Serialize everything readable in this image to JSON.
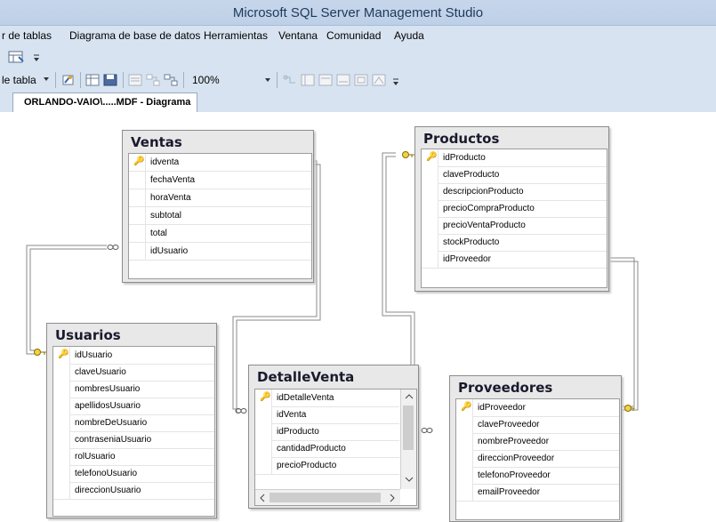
{
  "app": {
    "title": "Microsoft SQL Server Management Studio"
  },
  "menu": [
    "r de tablas",
    "Diagrama de base de datos",
    "Herramientas",
    "Ventana",
    "Comunidad",
    "Ayuda"
  ],
  "toolbar": {
    "table_view_label": "le tabla",
    "zoom": "100%"
  },
  "tab": {
    "label": "ORLANDO-VAIO\\.....MDF - Diagrama"
  },
  "tables": {
    "ventas": {
      "name": "Ventas",
      "columns": [
        "idventa",
        "fechaVenta",
        "horaVenta",
        "subtotal",
        "total",
        "idUsuario"
      ]
    },
    "productos": {
      "name": "Productos",
      "columns": [
        "idProducto",
        "claveProducto",
        "descripcionProducto",
        "precioCompraProducto",
        "precioVentaProducto",
        "stockProducto",
        "idProveedor"
      ]
    },
    "usuarios": {
      "name": "Usuarios",
      "columns": [
        "idUsuario",
        "claveUsuario",
        "nombresUsuario",
        "apellidosUsuario",
        "nombreDeUsuario",
        "contraseniaUsuario",
        "rolUsuario",
        "telefonoUsuario",
        "direccionUsuario"
      ]
    },
    "detalleventa": {
      "name": "DetalleVenta",
      "columns": [
        "idDetalleVenta",
        "idVenta",
        "idProducto",
        "cantidadProducto",
        "precioProducto"
      ]
    },
    "proveedores": {
      "name": "Proveedores",
      "columns": [
        "idProveedor",
        "claveProveedor",
        "nombreProveedor",
        "direccionProveedor",
        "telefonoProveedor",
        "emailProveedor"
      ]
    }
  },
  "icons": {
    "primary_key": "key-icon",
    "one_end": "key-connector-icon",
    "many_end": "infinity-icon"
  }
}
